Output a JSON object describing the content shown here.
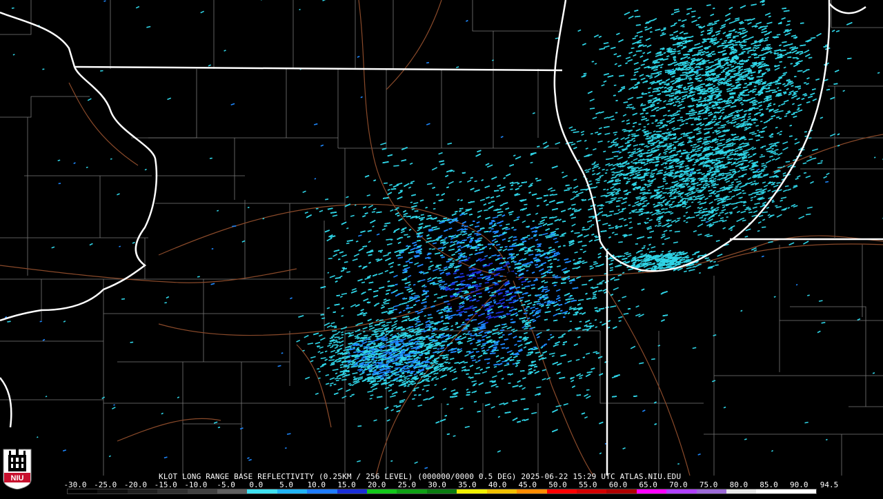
{
  "map": {
    "caption": "KLOT LONG RANGE BASE REFLECTIVITY (0.25KM / 256 LEVEL) (000000/0000 0.5 DEG) 2025-06-22 15:29 UTC  ATLAS.NIU.EDU",
    "radar_site": "KLOT",
    "product": "LONG RANGE BASE REFLECTIVITY",
    "timestamp": "2025-06-22 15:29 UTC",
    "source": "ATLAS.NIU.EDU",
    "logo_text": "NIU",
    "colors": {
      "echo_light": "#2fd4e6",
      "echo_mid": "#1e88ff",
      "echo_deep": "#1a2fd8",
      "state_line": "#ffffff",
      "county_line": "#7a7a7a",
      "road_line": "#8a4a2a",
      "niu_red": "#c8102e"
    }
  },
  "colorbar": {
    "ticks": [
      "-30.0",
      "-25.0",
      "-20.0",
      "-15.0",
      "-10.0",
      "-5.0",
      "0.0",
      "5.0",
      "10.0",
      "15.0",
      "20.0",
      "25.0",
      "30.0",
      "35.0",
      "40.0",
      "45.0",
      "50.0",
      "55.0",
      "60.0",
      "65.0",
      "70.0",
      "75.0",
      "80.0",
      "85.0",
      "90.0",
      "94.5"
    ],
    "segment_colors": [
      "#000000",
      "#101010",
      "#202020",
      "#303030",
      "#404040",
      "#606060",
      "#3fe0f0",
      "#21b4f5",
      "#1e7cff",
      "#1a2fd8",
      "#12c81a",
      "#0ea014",
      "#0a7c10",
      "#f0f000",
      "#f0c000",
      "#ff8c00",
      "#ff0000",
      "#d40000",
      "#b00000",
      "#ff00ff",
      "#b040ff",
      "#9c6ad8",
      "#e8e8e8",
      "#ffffff",
      "#ffffff"
    ]
  }
}
